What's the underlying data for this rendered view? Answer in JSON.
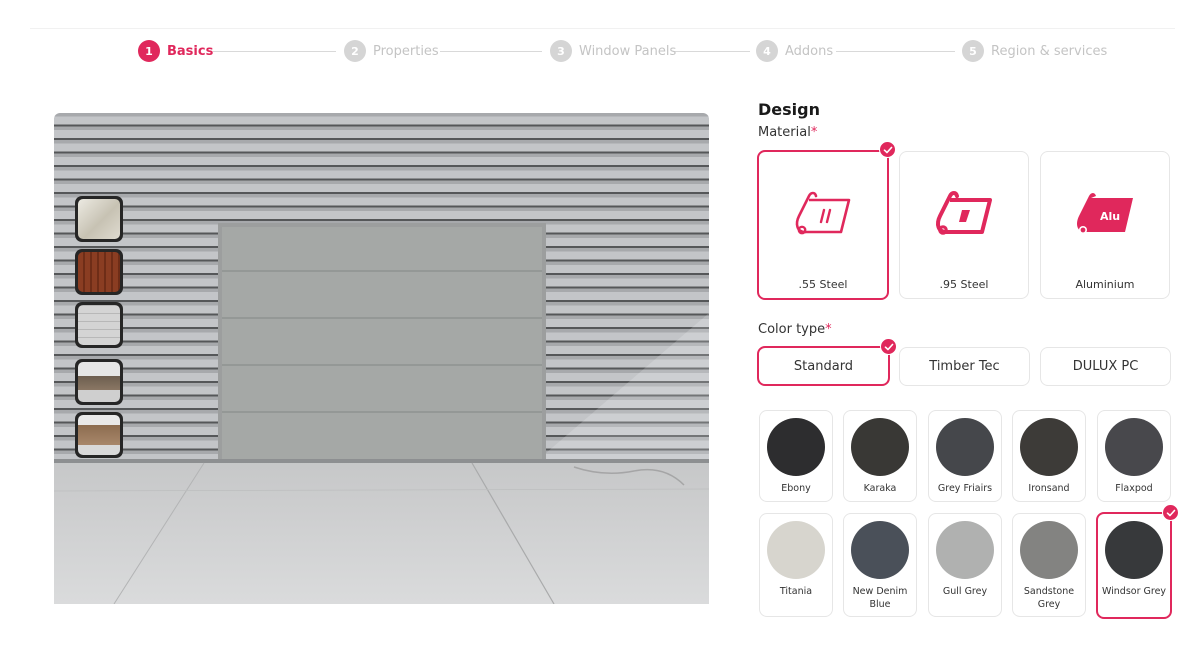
{
  "stepper": {
    "steps": [
      {
        "num": "1",
        "label": "Basics"
      },
      {
        "num": "2",
        "label": "Properties"
      },
      {
        "num": "3",
        "label": "Window Panels"
      },
      {
        "num": "4",
        "label": "Addons"
      },
      {
        "num": "5",
        "label": "Region & services"
      }
    ]
  },
  "design": {
    "title": "Design",
    "material_label": "Material",
    "required_mark": "*",
    "materials": [
      {
        "label": ".55 Steel",
        "icon": "steel-roll-icon",
        "selected": true
      },
      {
        "label": ".95 Steel",
        "icon": "steel-roll-heavy-icon",
        "selected": false
      },
      {
        "label": "Aluminium",
        "icon": "aluminium-roll-icon",
        "icon_text": "Alu",
        "selected": false
      }
    ],
    "color_type_label": "Color type",
    "color_types": [
      {
        "label": "Standard",
        "selected": true
      },
      {
        "label": "Timber Tec",
        "selected": false
      },
      {
        "label": "DULUX PC",
        "selected": false
      }
    ],
    "colors": [
      {
        "name": "Ebony",
        "hex": "#2d2d2f"
      },
      {
        "name": "Karaka",
        "hex": "#393835"
      },
      {
        "name": "Grey Friairs",
        "hex": "#45474b"
      },
      {
        "name": "Ironsand",
        "hex": "#3d3b38"
      },
      {
        "name": "Flaxpod",
        "hex": "#48484c"
      },
      {
        "name": "Titania",
        "hex": "#d7d5ce"
      },
      {
        "name": "New Denim Blue",
        "hex": "#4a5059"
      },
      {
        "name": "Gull Grey",
        "hex": "#b0b1b0"
      },
      {
        "name": "Sandstone Grey",
        "hex": "#838381"
      },
      {
        "name": "Windsor Grey",
        "hex": "#37393b",
        "selected": true
      }
    ]
  },
  "theme": {
    "accent": "#e0285c"
  }
}
